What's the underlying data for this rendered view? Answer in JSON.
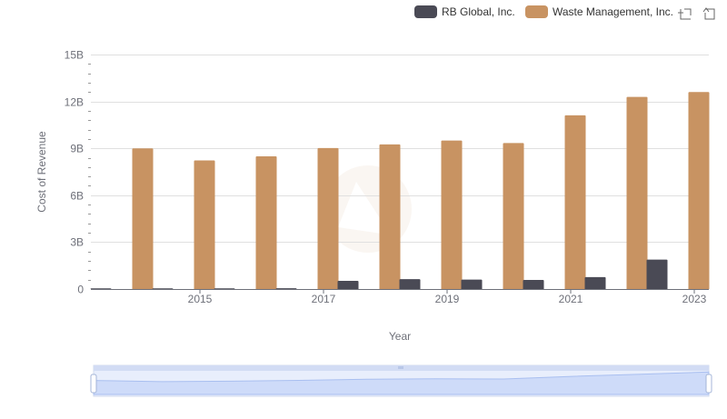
{
  "chart_data": {
    "type": "bar",
    "x": [
      "2014",
      "2015",
      "2016",
      "2017",
      "2018",
      "2019",
      "2020",
      "2021",
      "2022",
      "2023"
    ],
    "xticks": [
      "2015",
      "2017",
      "2019",
      "2021",
      "2023"
    ],
    "series": [
      {
        "name": "RB Global, Inc.",
        "color": "#4a4a55",
        "values": [
          0.03,
          0.03,
          0.04,
          0.05,
          0.52,
          0.63,
          0.6,
          0.58,
          0.76,
          1.88
        ]
      },
      {
        "name": "Waste Management, Inc.",
        "color": "#c89362",
        "values": [
          9.0,
          8.23,
          8.49,
          9.02,
          9.25,
          9.5,
          9.34,
          11.11,
          12.29,
          12.6
        ]
      }
    ],
    "unit_scale": 1000000000,
    "yticks": [
      "0",
      "3B",
      "6B",
      "9B",
      "12B",
      "15B"
    ],
    "ylim": [
      0,
      15
    ],
    "xlabel": "Year",
    "ylabel": "Cost of Revenue",
    "legend_position": "top-right",
    "grid": true
  }
}
